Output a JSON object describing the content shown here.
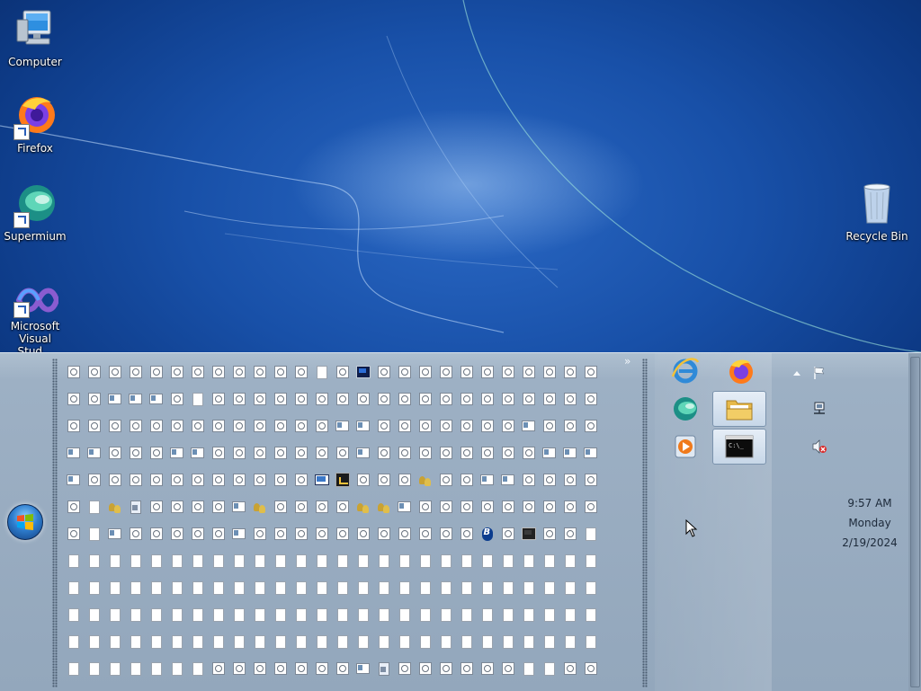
{
  "desktop": {
    "icons": [
      {
        "name": "computer-icon",
        "label": "Computer"
      },
      {
        "name": "firefox-icon",
        "label": "Firefox"
      },
      {
        "name": "supermium-icon",
        "label": "Supermium"
      },
      {
        "name": "visual-studio-icon",
        "label": "Microsoft Visual Stud..."
      },
      {
        "name": "recycle-bin-icon",
        "label": "Recycle Bin"
      }
    ]
  },
  "taskbar": {
    "overflow_chevron": "»",
    "notification_grid": {
      "columns": 26,
      "rows": [
        "ggggggggggggdgmggggggggggg",
        "ggwwwgdgggggggggggggggggg",
        "gggggggggggggwwgggggggwggg",
        "wwgggwwgggggggwggggggggwww",
        "wgggggggggggsaggguggwwgggg",
        "gducggggwugggguuwggggggggg",
        "gdwgggggwgggggggggggbgpggd",
        "dddddddddddddddddddddddddd",
        "dddddddddddddddddddddddddd",
        "dddddddddddddddddddddddddd",
        "dddddddddddddddddddddddddd",
        "dddddddgggggggwcggggggddgg"
      ]
    },
    "quick_launch": [
      {
        "name": "internet-explorer-icon",
        "pressed": false
      },
      {
        "name": "firefox-taskbar-icon",
        "pressed": false
      },
      {
        "name": "supermium-taskbar-icon",
        "pressed": false
      },
      {
        "name": "file-explorer-taskbar-icon",
        "pressed": true
      },
      {
        "name": "media-player-taskbar-icon",
        "pressed": false
      },
      {
        "name": "command-prompt-taskbar-icon",
        "pressed": true
      }
    ],
    "tray_icons": [
      {
        "name": "show-hidden-icons-arrow-icon"
      },
      {
        "name": "action-center-flag-icon"
      },
      {
        "name": "network-icon"
      },
      {
        "name": "volume-muted-icon"
      }
    ],
    "clock": {
      "time": "9:57 AM",
      "day": "Monday",
      "date": "2/19/2024"
    }
  }
}
